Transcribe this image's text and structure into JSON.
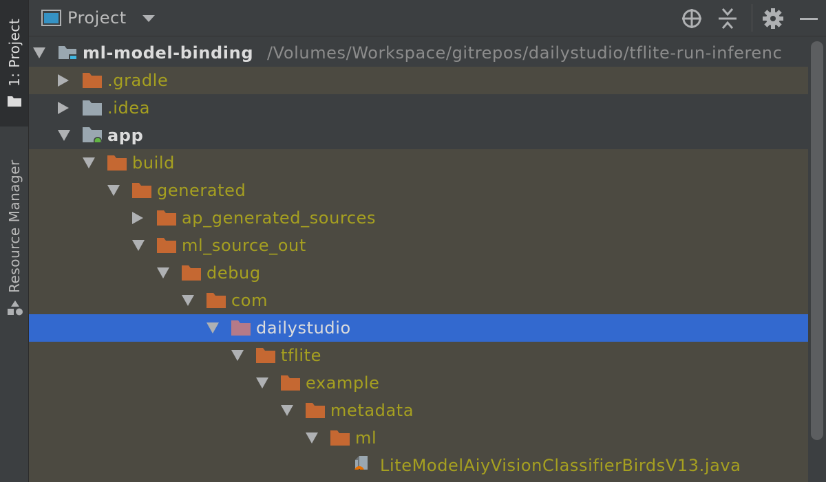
{
  "colors": {
    "tree_bg": "#4c4a41",
    "selection": "#3369cf",
    "excluded_text": "#a6a020",
    "folder_orange": "#c56832",
    "folder_grey": "#9aa7b0"
  },
  "side_strip": {
    "project_tab": "1: Project",
    "resource_tab": "Resource Manager"
  },
  "header": {
    "title": "Project",
    "buttons": [
      "locate-icon",
      "collapse-all-icon",
      "settings-icon",
      "hide-icon"
    ]
  },
  "tree": {
    "root": {
      "name": "ml-model-binding",
      "path": "/Volumes/Workspace/gitrepos/dailystudio/tflite-run-inferenc"
    },
    "items": [
      {
        "label": ".gradle",
        "icon": "folder-orange-icon"
      },
      {
        "label": ".idea",
        "icon": "folder-grey-icon"
      },
      {
        "label": "app",
        "icon": "module-folder-icon"
      },
      {
        "label": "build",
        "icon": "folder-orange-icon"
      },
      {
        "label": "generated",
        "icon": "folder-orange-icon"
      },
      {
        "label": "ap_generated_sources",
        "icon": "folder-orange-icon"
      },
      {
        "label": "ml_source_out",
        "icon": "folder-orange-icon"
      },
      {
        "label": "debug",
        "icon": "folder-orange-icon"
      },
      {
        "label": "com",
        "icon": "folder-orange-icon"
      },
      {
        "label": "dailystudio",
        "icon": "package-folder-icon"
      },
      {
        "label": "tflite",
        "icon": "folder-orange-icon"
      },
      {
        "label": "example",
        "icon": "folder-orange-icon"
      },
      {
        "label": "metadata",
        "icon": "folder-orange-icon"
      },
      {
        "label": "ml",
        "icon": "folder-orange-icon"
      },
      {
        "label": "LiteModelAiyVisionClassifierBirdsV13.java",
        "icon": "java-file-icon"
      }
    ]
  }
}
